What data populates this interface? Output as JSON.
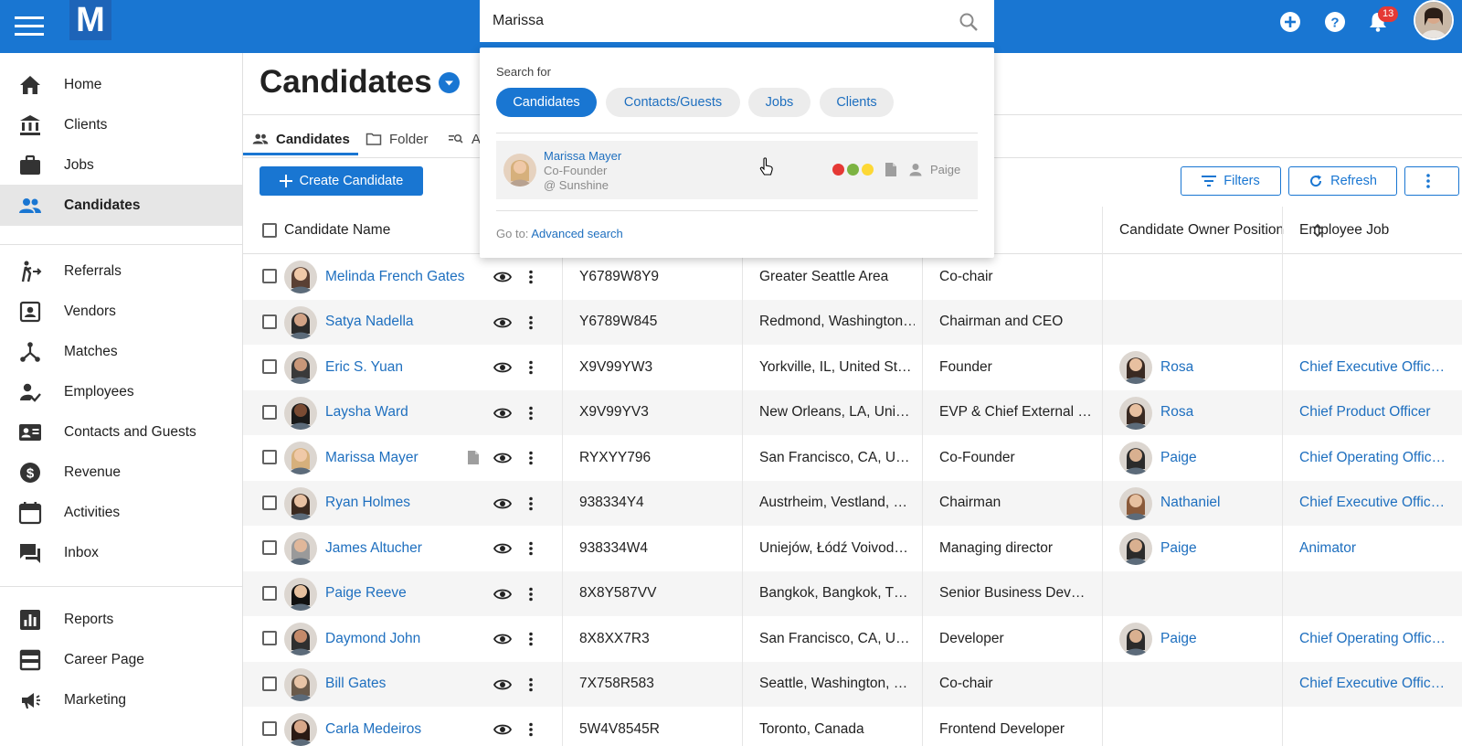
{
  "app": {
    "logo_letter": "M",
    "notification_count": "13"
  },
  "search": {
    "value": "Marissa",
    "placeholder": ""
  },
  "search_panel": {
    "label": "Search for",
    "chips": [
      "Candidates",
      "Contacts/Guests",
      "Jobs",
      "Clients"
    ],
    "result": {
      "name": "Marissa Mayer",
      "title": "Co-Founder",
      "company": "@ Sunshine",
      "owner": "Paige",
      "status_colors": [
        "#e53935",
        "#7cb342",
        "#fdd835"
      ]
    },
    "goto_label": "Go to:",
    "goto_link": "Advanced search"
  },
  "sidebar": {
    "items": [
      {
        "label": "Home",
        "icon": "home-icon"
      },
      {
        "label": "Clients",
        "icon": "bank-icon"
      },
      {
        "label": "Jobs",
        "icon": "briefcase-icon"
      },
      {
        "label": "Candidates",
        "icon": "people-icon",
        "active": true
      },
      {
        "label": "Referrals",
        "icon": "referral-icon"
      },
      {
        "label": "Vendors",
        "icon": "vendor-icon"
      },
      {
        "label": "Matches",
        "icon": "matches-icon"
      },
      {
        "label": "Employees",
        "icon": "employee-icon"
      },
      {
        "label": "Contacts and Guests",
        "icon": "contacts-icon"
      },
      {
        "label": "Revenue",
        "icon": "dollar-icon"
      },
      {
        "label": "Activities",
        "icon": "calendar-icon"
      },
      {
        "label": "Inbox",
        "icon": "inbox-icon"
      },
      {
        "label": "Reports",
        "icon": "reports-icon"
      },
      {
        "label": "Career Page",
        "icon": "career-page-icon"
      },
      {
        "label": "Marketing",
        "icon": "megaphone-icon"
      }
    ]
  },
  "main": {
    "title": "Candidates",
    "tabs": [
      "Candidates",
      "Folder",
      "A"
    ],
    "create_button": "Create Candidate",
    "filters_button": "Filters",
    "refresh_button": "Refresh"
  },
  "table": {
    "headers": {
      "name": "Candidate Name",
      "position": "Position",
      "owner": "Candidate Owner",
      "job": "Employee Job"
    },
    "rows": [
      {
        "name": "Melinda French Gates",
        "id": "Y6789W8Y9",
        "location": "Greater Seattle Area",
        "position": "Co-chair",
        "owner": "",
        "job": ""
      },
      {
        "name": "Satya Nadella",
        "id": "Y6789W845",
        "location": "Redmond, Washington…",
        "position": "Chairman and CEO",
        "owner": "",
        "job": ""
      },
      {
        "name": "Eric S. Yuan",
        "id": "X9V99YW3",
        "location": "Yorkville, IL, United St…",
        "position": "Founder",
        "owner": "Rosa",
        "job": "Chief Executive Offic…"
      },
      {
        "name": "Laysha Ward",
        "id": "X9V99YV3",
        "location": "New Orleans, LA, Uni…",
        "position": "EVP & Chief External …",
        "owner": "Rosa",
        "job": "Chief Product Officer"
      },
      {
        "name": "Marissa Mayer",
        "id": "RYXYY796",
        "location": "San Francisco, CA, U…",
        "position": "Co-Founder",
        "owner": "Paige",
        "job": "Chief Operating Offic…",
        "has_doc": true
      },
      {
        "name": "Ryan Holmes",
        "id": "938334Y4",
        "location": "Austrheim, Vestland, …",
        "position": "Chairman",
        "owner": "Nathaniel",
        "job": "Chief Executive Offic…"
      },
      {
        "name": "James Altucher",
        "id": "938334W4",
        "location": "Uniejów, Łódź Voivod…",
        "position": "Managing director",
        "owner": "Paige",
        "job": "Animator"
      },
      {
        "name": "Paige Reeve",
        "id": "8X8Y587VV",
        "location": "Bangkok, Bangkok, T…",
        "position": "Senior Business Dev…",
        "owner": "",
        "job": ""
      },
      {
        "name": "Daymond John",
        "id": "8X8XX7R3",
        "location": "San Francisco, CA, U…",
        "position": "Developer",
        "owner": "Paige",
        "job": "Chief Operating Offic…"
      },
      {
        "name": "Bill Gates",
        "id": "7X758R583",
        "location": "Seattle, Washington, …",
        "position": "Co-chair",
        "owner": "",
        "job": "Chief Executive Offic…"
      },
      {
        "name": "Carla Medeiros",
        "id": "5W4V8545R",
        "location": "Toronto, Canada",
        "position": "Frontend Developer",
        "owner": "",
        "job": ""
      }
    ]
  },
  "colors": {
    "brand": "#1976d2",
    "link": "#1e6fbf",
    "badge": "#e53935"
  }
}
